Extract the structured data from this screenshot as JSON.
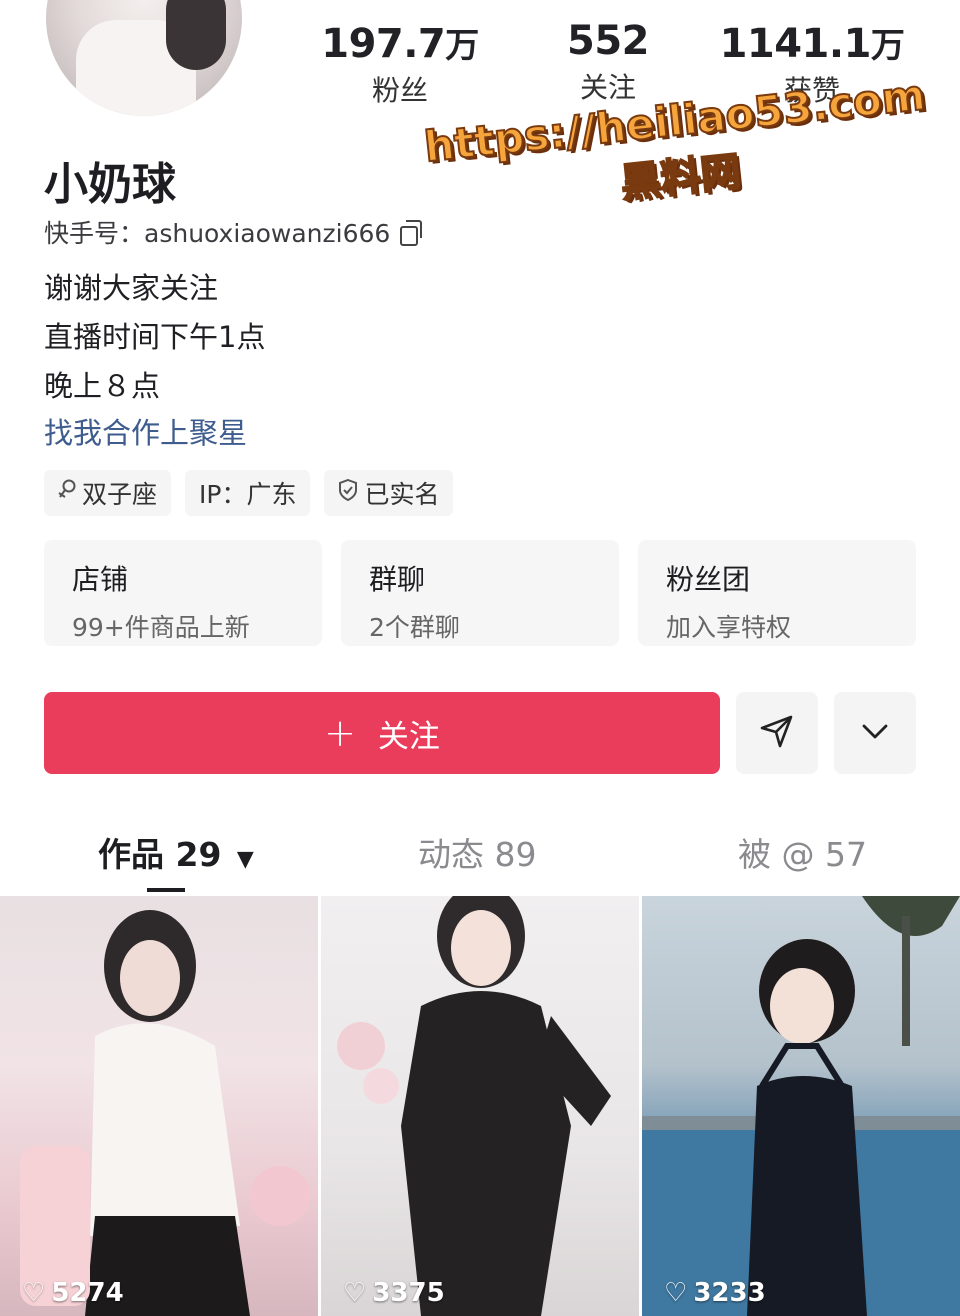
{
  "profile": {
    "name": "小奶球",
    "account": "快手号：ashuoxiaowanzi666",
    "bio": [
      "谢谢大家关注",
      "直播时间下午1点",
      "晚上８点"
    ],
    "bio_link": "找我合作上聚星"
  },
  "stats": [
    {
      "num": "197.7",
      "unit": "万",
      "label": "粉丝"
    },
    {
      "num": "552",
      "unit": "",
      "label": "关注"
    },
    {
      "num": "1141.1",
      "unit": "万",
      "label": "获赞"
    }
  ],
  "watermark": {
    "url": "https://heiliao53.com",
    "name": "黑料网"
  },
  "tags": [
    {
      "icon": "female-icon",
      "label": "双子座"
    },
    {
      "icon": "",
      "label": "IP：广东"
    },
    {
      "icon": "shield-check-icon",
      "label": "已实名"
    }
  ],
  "cards": [
    {
      "title": "店铺",
      "sub": "99+件商品上新"
    },
    {
      "title": "群聊",
      "sub": "2个群聊"
    },
    {
      "title": "粉丝团",
      "sub": "加入享特权"
    }
  ],
  "actions": {
    "follow_label": "关注",
    "share_icon": "send-icon",
    "more_icon": "chevron-down-icon"
  },
  "tabs": [
    {
      "label": "作品 29",
      "active": true
    },
    {
      "label": "动态 89",
      "active": false
    },
    {
      "label": "被 @ 57",
      "active": false
    }
  ],
  "videos": [
    {
      "likes": "5274"
    },
    {
      "likes": "3375"
    },
    {
      "likes": "3233"
    }
  ],
  "colors": {
    "accent": "#ea3d5c",
    "link": "#3e5c8e",
    "watermark": "#f5a53c"
  }
}
